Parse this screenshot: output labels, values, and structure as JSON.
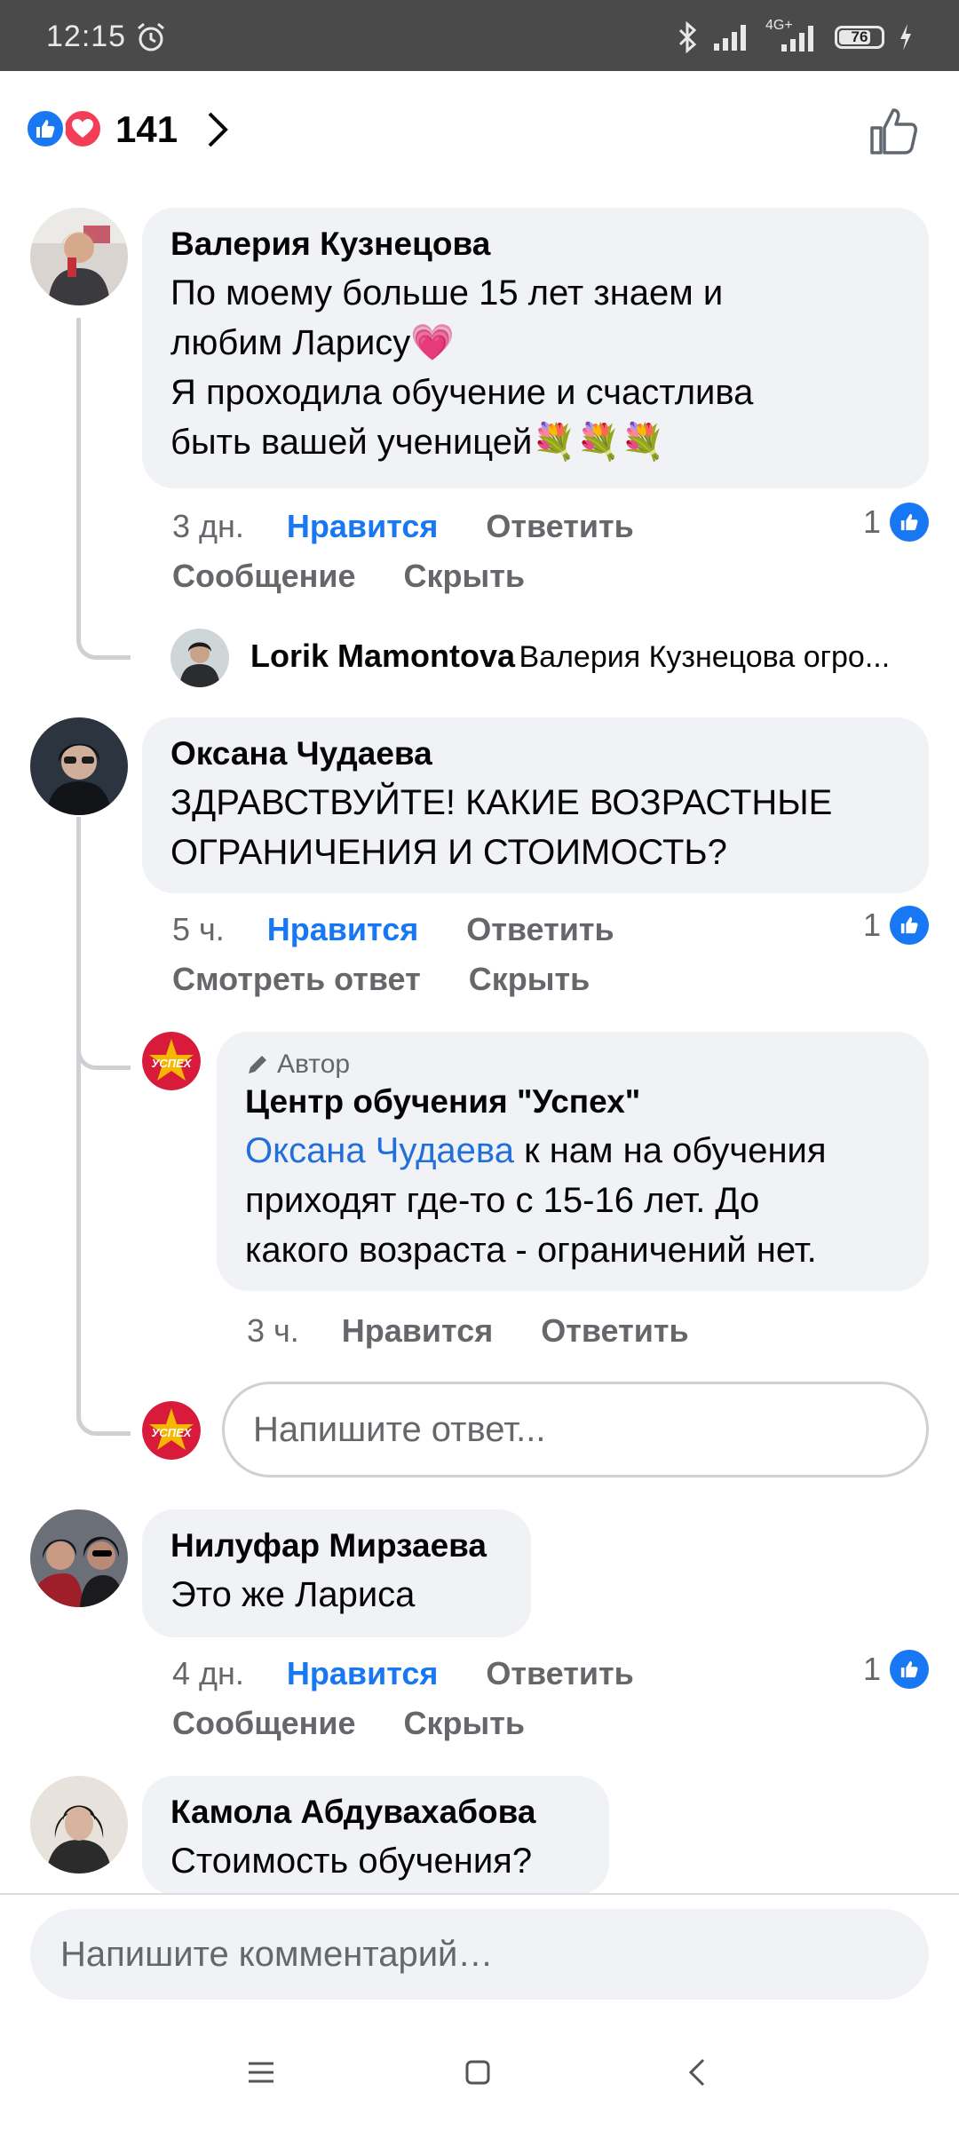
{
  "status_bar": {
    "time": "12:15",
    "network": "4G+",
    "battery": "76"
  },
  "reactions": {
    "count": "141"
  },
  "comments": [
    {
      "author": "Валерия Кузнецова",
      "lines": [
        "По моему больше 15 лет знаем и",
        "любим  Ларису💗",
        "Я проходила обучение и счастлива",
        "быть вашей ученицей💐💐💐"
      ],
      "time": "3 дн.",
      "like": "Нравится",
      "reply": "Ответить",
      "extra1": "Сообщение",
      "extra2": "Скрыть",
      "reaction_count": "1",
      "reply_preview": {
        "author": "Lorik Mamontova",
        "text": "Валерия Кузнецова огро..."
      }
    },
    {
      "author": "Оксана Чудаева",
      "lines": [
        "ЗДРАВСТВУЙТЕ! КАКИЕ ВОЗРАСТНЫЕ",
        "ОГРАНИЧЕНИЯ И СТОИМОСТЬ?"
      ],
      "time": "5 ч.",
      "like": "Нравится",
      "reply": "Ответить",
      "extra1": "Смотреть ответ",
      "extra2": "Скрыть",
      "reaction_count": "1",
      "page_reply": {
        "badge": "Автор",
        "author": "Центр обучения \"Успех\"",
        "mention": "Оксана Чудаева",
        "line1_rest": " к нам на обучения",
        "line2": "приходят где-то с 15-16 лет. До",
        "line3": "какого возраста - ограничений нет.",
        "time": "3 ч.",
        "like": "Нравится",
        "reply": "Ответить"
      },
      "reply_placeholder": "Напишите ответ..."
    },
    {
      "author": "Нилуфар Мирзаева",
      "lines": [
        "Это же Лариса"
      ],
      "time": "4 дн.",
      "like": "Нравится",
      "reply": "Ответить",
      "extra1": "Сообщение",
      "extra2": "Скрыть",
      "reaction_count": "1"
    },
    {
      "author": "Камола Абдувахабова",
      "lines": [
        "Стоимость обучения?"
      ]
    }
  ],
  "composer": {
    "placeholder": "Напишите комментарий…"
  },
  "page_logo_text": "УСПЕХ",
  "colors": {
    "like_blue": "#1877f2",
    "bubble_gray": "#f0f2f5",
    "love_red": "#f33e58",
    "logo_red": "#d81b3a"
  }
}
